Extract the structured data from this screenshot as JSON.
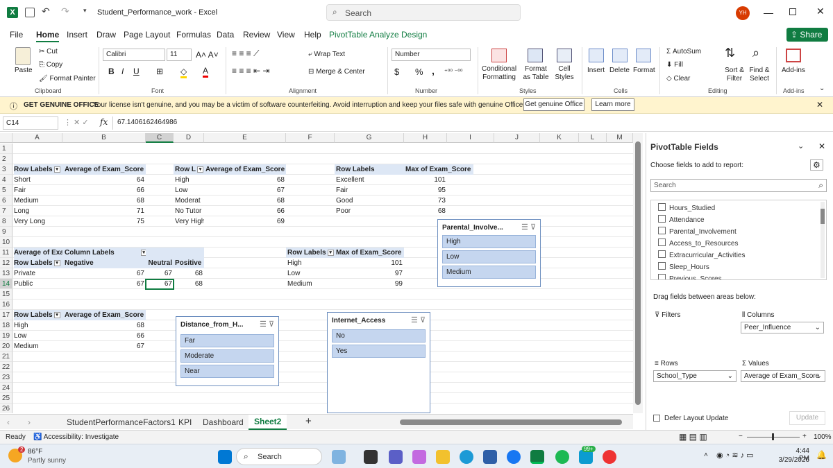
{
  "title_bar": {
    "file_name": "Student_Performance_work",
    "app_name": "Excel",
    "search_placeholder": "Search",
    "user_initials": "YH"
  },
  "menu_tabs": [
    "File",
    "Home",
    "Insert",
    "Draw",
    "Page Layout",
    "Formulas",
    "Data",
    "Review",
    "View",
    "Help",
    "PivotTable Analyze",
    "Design"
  ],
  "share_label": "Share",
  "ribbon": {
    "clipboard": {
      "paste": "Paste",
      "cut": "Cut",
      "copy": "Copy",
      "format_painter": "Format Painter",
      "group": "Clipboard"
    },
    "font": {
      "name": "Calibri",
      "size": "11",
      "group": "Font",
      "bold": "B",
      "italic": "I",
      "underline": "U"
    },
    "alignment": {
      "wrap": "Wrap Text",
      "merge": "Merge & Center",
      "group": "Alignment"
    },
    "number": {
      "format": "Number",
      "currency": "$",
      "percent": "%",
      "comma": ",",
      "group": "Number"
    },
    "styles": {
      "conditional": "Conditional Formatting",
      "format_table": "Format as Table",
      "cell_styles": "Cell Styles",
      "group": "Styles"
    },
    "cells": {
      "insert": "Insert",
      "delete": "Delete",
      "format": "Format",
      "group": "Cells"
    },
    "editing": {
      "autosum": "AutoSum",
      "fill": "Fill",
      "clear": "Clear",
      "sort": "Sort & Filter",
      "find": "Find & Select",
      "group": "Editing"
    },
    "addins": {
      "label": "Add-ins",
      "group": "Add-ins"
    }
  },
  "message_bar": {
    "title": "GET GENUINE OFFICE",
    "text": "Your license isn't genuine, and you may be a victim of software counterfeiting. Avoid interruption and keep your files safe with genuine Office today.",
    "button1": "Get genuine Office",
    "button2": "Learn more"
  },
  "formula_bar": {
    "name_box": "C14",
    "fx": "fx",
    "value": "67.1406162464986"
  },
  "columns": [
    "A",
    "B",
    "C",
    "D",
    "E",
    "F",
    "G",
    "H",
    "I",
    "J",
    "K",
    "L",
    "M"
  ],
  "rows": [
    "1",
    "2",
    "3",
    "4",
    "5",
    "6",
    "7",
    "8",
    "9",
    "10",
    "11",
    "12",
    "13",
    "14",
    "15",
    "16",
    "17",
    "18",
    "19",
    "20",
    "21",
    "22",
    "23",
    "24",
    "25",
    "26"
  ],
  "pivot1": {
    "h1": "Row Labels",
    "h2": "Average of Exam_Score",
    "rows": [
      [
        "Short",
        "64"
      ],
      [
        "Fair",
        "66"
      ],
      [
        "Medium",
        "68"
      ],
      [
        "Long",
        "71"
      ],
      [
        "Very Long",
        "75"
      ]
    ]
  },
  "pivot2": {
    "h1": "Row L",
    "h2": "Average of Exam_Score",
    "rows": [
      [
        "High",
        "68"
      ],
      [
        "Low",
        "67"
      ],
      [
        "Moderat",
        "68"
      ],
      [
        "No Tutor",
        "66"
      ],
      [
        "Very High",
        "69"
      ]
    ]
  },
  "pivot3": {
    "h1": "Row Labels",
    "h2": "Max of Exam_Score",
    "rows": [
      [
        "Excellent",
        "101"
      ],
      [
        "Fair",
        "95"
      ],
      [
        "Good",
        "73"
      ],
      [
        "Poor",
        "68"
      ]
    ]
  },
  "pivot4": {
    "h1": "Average of Exa",
    "h2": "Column Labels",
    "r12a": "Row Labels",
    "r12b": "Negative",
    "r12c": "Neutral",
    "r12d": "Positive",
    "rows": [
      [
        "Private",
        "67",
        "67",
        "68"
      ],
      [
        "Public",
        "67",
        "67",
        "68"
      ]
    ]
  },
  "pivot5": {
    "h1": "Row Labels",
    "h2": "Max of Exam_Score",
    "rows": [
      [
        "High",
        "101"
      ],
      [
        "Low",
        "97"
      ],
      [
        "Medium",
        "99"
      ]
    ]
  },
  "pivot6": {
    "h1": "Row Labels",
    "h2": "Average of Exam_Score",
    "rows": [
      [
        "High",
        "68"
      ],
      [
        "Low",
        "66"
      ],
      [
        "Medium",
        "67"
      ]
    ]
  },
  "slicers": {
    "parental": {
      "title": "Parental_Involve...",
      "items": [
        "High",
        "Low",
        "Medium"
      ]
    },
    "distance": {
      "title": "Distance_from_H...",
      "items": [
        "Far",
        "Moderate",
        "Near"
      ]
    },
    "internet": {
      "title": "Internet_Access",
      "items": [
        "No",
        "Yes"
      ]
    }
  },
  "sheet_tabs": [
    "StudentPerformanceFactors1",
    "KPI",
    "Dashboard",
    "Sheet2"
  ],
  "pivot_pane": {
    "title": "PivotTable Fields",
    "subtitle": "Choose fields to add to report:",
    "search_placeholder": "Search",
    "fields": [
      "Hours_Studied",
      "Attendance",
      "Parental_Involvement",
      "Access_to_Resources",
      "Extracurricular_Activities",
      "Sleep_Hours",
      "Previous_Scores"
    ],
    "drag_label": "Drag fields between areas below:",
    "filters": "Filters",
    "columns": "Columns",
    "columns_value": "Peer_Influence",
    "rows_label": "Rows",
    "rows_value": "School_Type",
    "values_label": "Values",
    "values_value": "Average of Exam_Score",
    "defer": "Defer Layout Update",
    "update": "Update"
  },
  "status": {
    "ready": "Ready",
    "accessibility": "Accessibility: Investigate",
    "zoom": "100%"
  },
  "taskbar": {
    "temp": "86°F",
    "weather": "Partly sunny",
    "badge": "2",
    "search": "Search",
    "notif": "99+",
    "time": "4:44 PM",
    "date": "3/29/2026"
  }
}
